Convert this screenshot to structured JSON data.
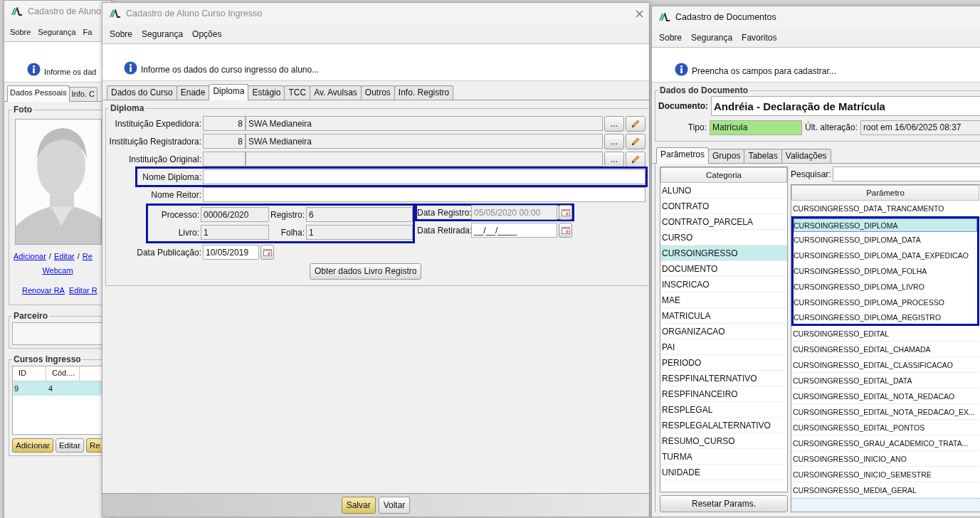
{
  "aluno_window": {
    "title": "Cadastro de Aluno",
    "active": false,
    "menu": [
      "Sobre",
      "Segurança",
      "Fa"
    ],
    "info": "Informe os dad",
    "tabs": [
      {
        "label": "Dados Pessoais",
        "selected": true
      },
      {
        "label": "Info. C",
        "selected": false
      }
    ],
    "photo_group": {
      "title": "Foto",
      "links": [
        "Adicionar",
        "Editar",
        "Re"
      ],
      "separator": "/",
      "webcam": "Webcam",
      "extra_links": [
        "Renovar RA",
        "Editar R"
      ]
    },
    "partner_group": {
      "title": "Parceiro"
    },
    "courses_group": {
      "title": "Cursos Ingresso",
      "columns": [
        "ID",
        "Cód...."
      ],
      "rows": [
        {
          "cells": [
            "9",
            "4"
          ],
          "selected": true
        }
      ],
      "buttons": [
        {
          "label": "Adicionar",
          "primary": true
        },
        {
          "label": "Editar",
          "primary": false
        },
        {
          "label": "Re",
          "primary": true
        }
      ]
    }
  },
  "curso_window": {
    "title": "Cadastro de Aluno Curso Ingresso",
    "active": false,
    "menu": [
      "Sobre",
      "Segurança",
      "Opções"
    ],
    "info": "Informe os dados do curso ingresso do aluno...",
    "tabs": [
      {
        "label": "Dados do Curso",
        "selected": false
      },
      {
        "label": "Enade",
        "selected": false
      },
      {
        "label": "Diploma",
        "selected": true
      },
      {
        "label": "Estágio",
        "selected": false
      },
      {
        "label": "TCC",
        "selected": false
      },
      {
        "label": "Av. Avulsas",
        "selected": false
      },
      {
        "label": "Outros",
        "selected": false
      },
      {
        "label": "Info. Registro",
        "selected": false
      }
    ],
    "group_title": "Diploma",
    "rows": [
      {
        "kind": "lookup",
        "label": "Instituição Expedidora:",
        "code": "8",
        "value": "SWA Medianeira",
        "button": "..."
      },
      {
        "kind": "lookup",
        "label": "Instituição Registradora:",
        "code": "8",
        "value": "SWA Medianeira",
        "button": "..."
      },
      {
        "kind": "lookup",
        "label": "Instituição Original:",
        "button": "..."
      },
      {
        "kind": "text",
        "label": "Nome Diploma:",
        "highlighted": true
      },
      {
        "kind": "text",
        "label": "Nome Reitor:",
        "highlighted": false
      },
      {
        "kind": "register",
        "highlighted": true,
        "fields": [
          {
            "label": "Processo:",
            "value": "00006/2020"
          },
          {
            "label": "Registro:",
            "value": "6"
          },
          {
            "label": "Livro:",
            "value": "1"
          },
          {
            "label": "Folha:",
            "value": "1"
          }
        ],
        "dates": [
          {
            "label": "Data Registro:",
            "value": "05/05/2020 00:00",
            "disabled": true,
            "highlighted": true
          },
          {
            "label": "Data Retirada:",
            "value": "__/__/____",
            "disabled": false,
            "highlighted": false
          }
        ]
      },
      {
        "kind": "date",
        "label": "Data Publicação:",
        "value": "10/05/2019"
      },
      {
        "kind": "action",
        "label": "Obter dados Livro Registro"
      }
    ],
    "footer_buttons": [
      {
        "label": "Salvar",
        "primary": true
      },
      {
        "label": "Voltar",
        "primary": false
      }
    ]
  },
  "documentos_window": {
    "title": "Cadastro de Documentos",
    "active": true,
    "menu": [
      "Sobre",
      "Segurança",
      "Favoritos"
    ],
    "info": "Preencha os campos para cadastrar...",
    "group_title": "Dados do Documento",
    "documento_label": "Documento:",
    "documento": "Andréia - Declaração de Matrícula",
    "tipo_label": "Tipo:",
    "tipo": "Matrícula",
    "alteracao_label": "Últ. alteração:",
    "alteracao": "root em 16/06/2025 08:37",
    "tabs": [
      {
        "label": "Parâmetros",
        "selected": true
      },
      {
        "label": "Grupos",
        "selected": false
      },
      {
        "label": "Tabelas",
        "selected": false
      },
      {
        "label": "Validações",
        "selected": false
      }
    ],
    "categories_header": "Categoria",
    "categories": [
      {
        "label": "ALUNO",
        "selected": false
      },
      {
        "label": "CONTRATO",
        "selected": false
      },
      {
        "label": "CONTRATO_PARCELA",
        "selected": false
      },
      {
        "label": "CURSO",
        "selected": false
      },
      {
        "label": "CURSOINGRESSO",
        "selected": true
      },
      {
        "label": "DOCUMENTO",
        "selected": false
      },
      {
        "label": "INSCRICAO",
        "selected": false
      },
      {
        "label": "MAE",
        "selected": false
      },
      {
        "label": "MATRICULA",
        "selected": false
      },
      {
        "label": "ORGANIZACAO",
        "selected": false
      },
      {
        "label": "PAI",
        "selected": false
      },
      {
        "label": "PERIODO",
        "selected": false
      },
      {
        "label": "RESPFINALTERNATIVO",
        "selected": false
      },
      {
        "label": "RESPFINANCEIRO",
        "selected": false
      },
      {
        "label": "RESPLEGAL",
        "selected": false
      },
      {
        "label": "RESPLEGALALTERNATIVO",
        "selected": false
      },
      {
        "label": "RESUMO_CURSO",
        "selected": false
      },
      {
        "label": "TURMA",
        "selected": false
      },
      {
        "label": "UNIDADE",
        "selected": false
      }
    ],
    "reset_button": "Resetar Params.",
    "search_label": "Pesquisar:",
    "parameters_header": "Parâmetro",
    "parameters": [
      {
        "label": "CURSOINGRESSO_DATA_TRANCAMENTO",
        "selected": false,
        "highlighted": false
      },
      {
        "label": "CURSOINGRESSO_DIPLOMA",
        "selected": true,
        "highlighted": true
      },
      {
        "label": "CURSOINGRESSO_DIPLOMA_DATA",
        "selected": false,
        "highlighted": true
      },
      {
        "label": "CURSOINGRESSO_DIPLOMA_DATA_EXPEDICAO",
        "selected": false,
        "highlighted": true
      },
      {
        "label": "CURSOINGRESSO_DIPLOMA_FOLHA",
        "selected": false,
        "highlighted": true
      },
      {
        "label": "CURSOINGRESSO_DIPLOMA_LIVRO",
        "selected": false,
        "highlighted": true
      },
      {
        "label": "CURSOINGRESSO_DIPLOMA_PROCESSO",
        "selected": false,
        "highlighted": true
      },
      {
        "label": "CURSOINGRESSO_DIPLOMA_REGISTRO",
        "selected": false,
        "highlighted": true
      },
      {
        "label": "CURSOINGRESSO_EDITAL",
        "selected": false,
        "highlighted": false
      },
      {
        "label": "CURSOINGRESSO_EDITAL_CHAMADA",
        "selected": false,
        "highlighted": false
      },
      {
        "label": "CURSOINGRESSO_EDITAL_CLASSIFICACAO",
        "selected": false,
        "highlighted": false
      },
      {
        "label": "CURSOINGRESSO_EDITAL_DATA",
        "selected": false,
        "highlighted": false
      },
      {
        "label": "CURSOINGRESSO_EDITAL_NOTA_REDACAO",
        "selected": false,
        "highlighted": false
      },
      {
        "label": "CURSOINGRESSO_EDITAL_NOTA_REDACAO_EX...",
        "selected": false,
        "highlighted": false
      },
      {
        "label": "CURSOINGRESSO_EDITAL_PONTOS",
        "selected": false,
        "highlighted": false
      },
      {
        "label": "CURSOINGRESSO_GRAU_ACADEMICO_TRATA...",
        "selected": false,
        "highlighted": false
      },
      {
        "label": "CURSOINGRESSO_INICIO_ANO",
        "selected": false,
        "highlighted": false
      },
      {
        "label": "CURSOINGRESSO_INICIO_SEMESTRE",
        "selected": false,
        "highlighted": false
      },
      {
        "label": "CURSOINGRESSO_MEDIA_GERAL",
        "selected": false,
        "highlighted": false
      }
    ]
  }
}
